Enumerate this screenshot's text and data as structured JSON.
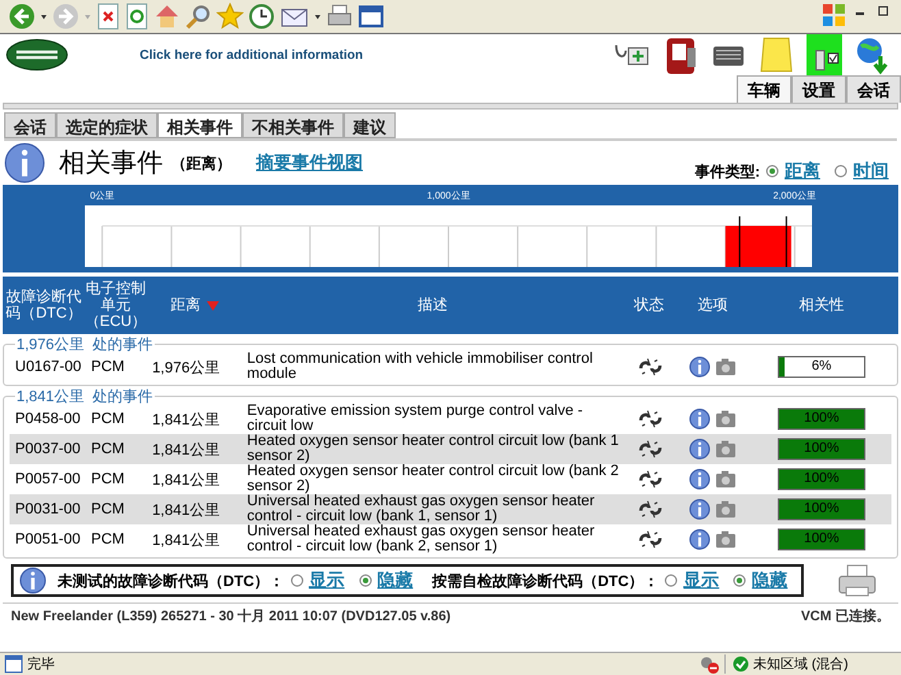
{
  "header": {
    "info_link": "Click here for additional information"
  },
  "top_tabs": [
    {
      "label": "车辆",
      "selected": true
    },
    {
      "label": "设置",
      "selected": false
    },
    {
      "label": "会话",
      "selected": false
    }
  ],
  "nav_tabs": [
    {
      "label": "会话",
      "selected": false
    },
    {
      "label": "选定的症状",
      "selected": false
    },
    {
      "label": "相关事件",
      "selected": true
    },
    {
      "label": "不相关事件",
      "selected": false
    },
    {
      "label": "建议",
      "selected": false
    }
  ],
  "page": {
    "title": "相关事件",
    "subtitle": "（距离）",
    "summary_link": "摘要事件视图",
    "event_type_label": "事件类型:",
    "event_types": [
      {
        "label": "距离",
        "selected": true
      },
      {
        "label": "时间",
        "selected": false
      }
    ]
  },
  "timeline": {
    "tick_labels": [
      "0公里",
      "1,000公里",
      "2,000公里"
    ]
  },
  "table": {
    "columns": [
      {
        "label": "故障诊断代码（DTC）",
        "sorted": false
      },
      {
        "label": "电子控制单元（ECU）",
        "sorted": false
      },
      {
        "label": "距离",
        "sorted": true
      },
      {
        "label": "描述",
        "sorted": false
      },
      {
        "label": "状态",
        "sorted": false
      },
      {
        "label": "选项",
        "sorted": false
      },
      {
        "label": "相关性",
        "sorted": false
      }
    ]
  },
  "groups": [
    {
      "heading": "1,976公里  处的事件",
      "rows": [
        {
          "dtc": "U0167-00",
          "ecu": "PCM",
          "distance": "1,976公里",
          "description": "Lost communication with vehicle immobiliser control module",
          "relevance": "6%",
          "level": 0.06
        }
      ]
    },
    {
      "heading": "1,841公里  处的事件",
      "rows": [
        {
          "dtc": "P0458-00",
          "ecu": "PCM",
          "distance": "1,841公里",
          "description": "Evaporative emission system purge control valve - circuit low",
          "relevance": "100%",
          "level": 1
        },
        {
          "dtc": "P0037-00",
          "ecu": "PCM",
          "distance": "1,841公里",
          "description": "Heated oxygen sensor heater control circuit low (bank 1 sensor 2)",
          "relevance": "100%",
          "level": 1
        },
        {
          "dtc": "P0057-00",
          "ecu": "PCM",
          "distance": "1,841公里",
          "description": "Heated oxygen sensor heater control circuit low (bank 2 sensor 2)",
          "relevance": "100%",
          "level": 1
        },
        {
          "dtc": "P0031-00",
          "ecu": "PCM",
          "distance": "1,841公里",
          "description": "Universal heated exhaust gas oxygen sensor heater control - circuit low (bank 1, sensor 1)",
          "relevance": "100%",
          "level": 1
        },
        {
          "dtc": "P0051-00",
          "ecu": "PCM",
          "distance": "1,841公里",
          "description": "Universal heated exhaust gas oxygen sensor heater control - circuit low (bank 2, sensor 1)",
          "relevance": "100%",
          "level": 1
        }
      ]
    }
  ],
  "filters": [
    {
      "label": "未测试的故障诊断代码（DTC）：",
      "options": [
        {
          "label": "显示",
          "selected": false
        },
        {
          "label": "隐藏",
          "selected": true
        }
      ]
    },
    {
      "label": "按需自检故障诊断代码（DTC）：",
      "options": [
        {
          "label": "显示",
          "selected": false
        },
        {
          "label": "隐藏",
          "selected": true
        }
      ]
    }
  ],
  "footer": {
    "vehicle_info": "New Freelander (L359) 265271 - 30 十月  2011 10:07 (DVD127.05 v.86)",
    "connection": "VCM 已连接。"
  },
  "status_bar": {
    "text": "完毕",
    "zone": "未知区域 (混合)"
  }
}
